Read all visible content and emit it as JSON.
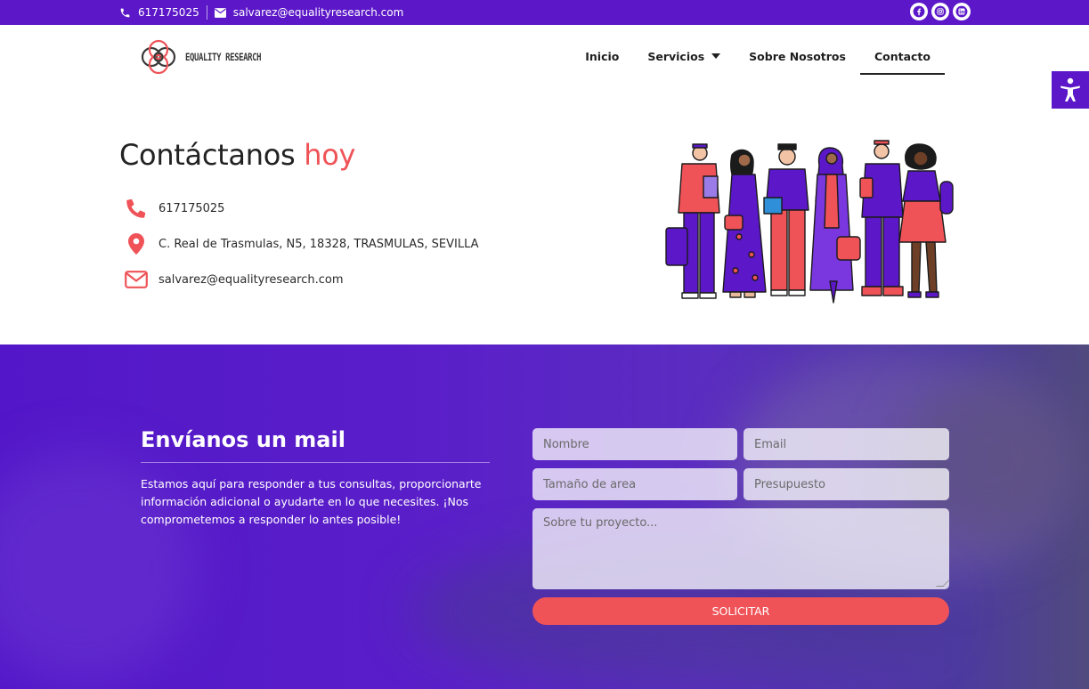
{
  "topbar": {
    "phone": "617175025",
    "email": "salvarez@equalityresearch.com",
    "social": [
      "facebook-icon",
      "instagram-icon",
      "linkedin-icon"
    ]
  },
  "header": {
    "logo_text": "EQUALITY RESEARCH",
    "nav": [
      {
        "label": "Inicio"
      },
      {
        "label": "Servicios"
      },
      {
        "label": "Sobre Nosotros"
      },
      {
        "label": "Contacto",
        "active": true
      }
    ]
  },
  "contact": {
    "title_main": "Contáctanos",
    "title_highlight": "hoy",
    "phone": "617175025",
    "address": "C. Real de Trasmulas, N5, 18328, TRASMULAS, SEVILLA",
    "email": "salvarez@equalityresearch.com"
  },
  "form_section": {
    "title": "Envíanos un mail",
    "description": "Estamos aquí para responder a tus consultas, proporcionarte información adicional o ayudarte en lo que necesites. ¡Nos comprometemos a responder lo antes posible!",
    "fields": {
      "name_placeholder": "Nombre",
      "email_placeholder": "Email",
      "area_placeholder": "Tamaño de area",
      "budget_placeholder": "Presupuesto",
      "project_placeholder": "Sobre tu proyecto..."
    },
    "submit_label": "SOLICITAR"
  },
  "colors": {
    "brand_purple": "#5b17c8",
    "accent_red": "#ef5358"
  }
}
